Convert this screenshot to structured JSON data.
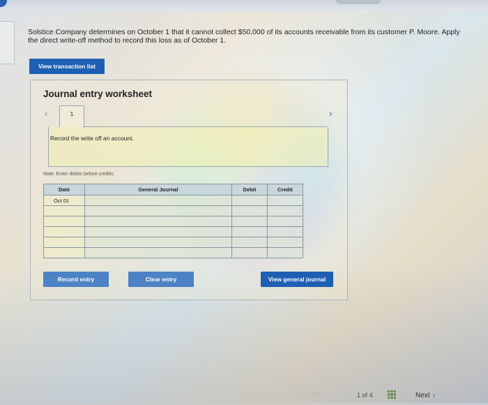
{
  "question": {
    "line1": "Solstice Company determines on October 1 that it cannot collect $50,000 of its accounts receivable from its customer P. Moore. Apply",
    "line2": "the direct write-off method to record this loss as of October 1."
  },
  "view_transaction_list": "View transaction list",
  "worksheet": {
    "title": "Journal entry worksheet",
    "tab_number": "1",
    "instruction": "Record the write off an account.",
    "note": "Note: Enter debits before credits.",
    "columns": [
      "Date",
      "General Journal",
      "Debit",
      "Credit"
    ],
    "rows": [
      {
        "date": "Oct 01",
        "account": "",
        "debit": "",
        "credit": ""
      },
      {
        "date": "",
        "account": "",
        "debit": "",
        "credit": ""
      },
      {
        "date": "",
        "account": "",
        "debit": "",
        "credit": ""
      },
      {
        "date": "",
        "account": "",
        "debit": "",
        "credit": ""
      },
      {
        "date": "",
        "account": "",
        "debit": "",
        "credit": ""
      },
      {
        "date": "",
        "account": "",
        "debit": "",
        "credit": ""
      }
    ],
    "buttons": {
      "record": "Record entry",
      "clear": "Clear entry",
      "view_journal": "View general journal"
    }
  },
  "footer": {
    "prev": "Prev",
    "page_current": "1",
    "page_of": "of",
    "page_total": "4",
    "next": "Next"
  }
}
